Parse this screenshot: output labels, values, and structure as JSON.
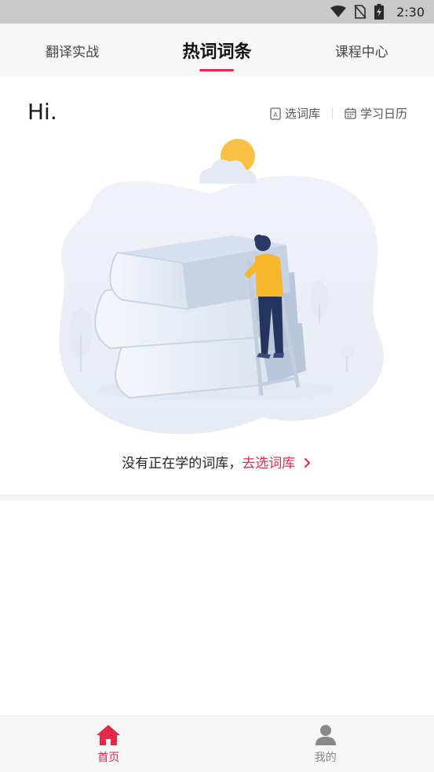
{
  "status_bar": {
    "time": "2:30",
    "icons": [
      "wifi-icon",
      "no-sim-icon",
      "battery-charging-icon"
    ]
  },
  "top_tabs": [
    {
      "label": "翻译实战",
      "active": false
    },
    {
      "label": "热词词条",
      "active": true
    },
    {
      "label": "课程中心",
      "active": false
    }
  ],
  "greeting": "Hi.",
  "actions": {
    "select_library": {
      "label": "选词库",
      "icon": "library-icon"
    },
    "calendar": {
      "label": "学习日历",
      "icon": "calendar-icon"
    }
  },
  "empty_state": {
    "message": "没有正在学的词库，",
    "link_label": "去选词库",
    "link_icon": "chevron-right-icon"
  },
  "bottom_nav": [
    {
      "label": "首页",
      "icon": "home-icon",
      "active": true
    },
    {
      "label": "我的",
      "icon": "user-icon",
      "active": false
    }
  ],
  "colors": {
    "accent": "#e2294a",
    "inactive": "#888888",
    "status_bar": "#c9c9c9"
  }
}
